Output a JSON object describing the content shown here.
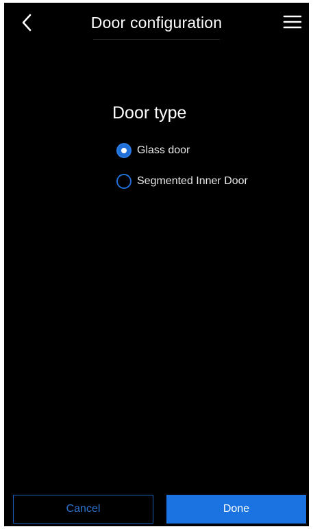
{
  "header": {
    "title": "Door configuration",
    "back_icon": "chevron-left-icon",
    "menu_icon": "hamburger-menu-icon"
  },
  "section": {
    "title": "Door type",
    "options": [
      {
        "label": "Glass door",
        "selected": true
      },
      {
        "label": "Segmented Inner Door",
        "selected": false
      }
    ]
  },
  "footer": {
    "cancel_label": "Cancel",
    "done_label": "Done"
  },
  "colors": {
    "background": "#000000",
    "accent": "#1a73e0",
    "text": "#ffffff"
  }
}
